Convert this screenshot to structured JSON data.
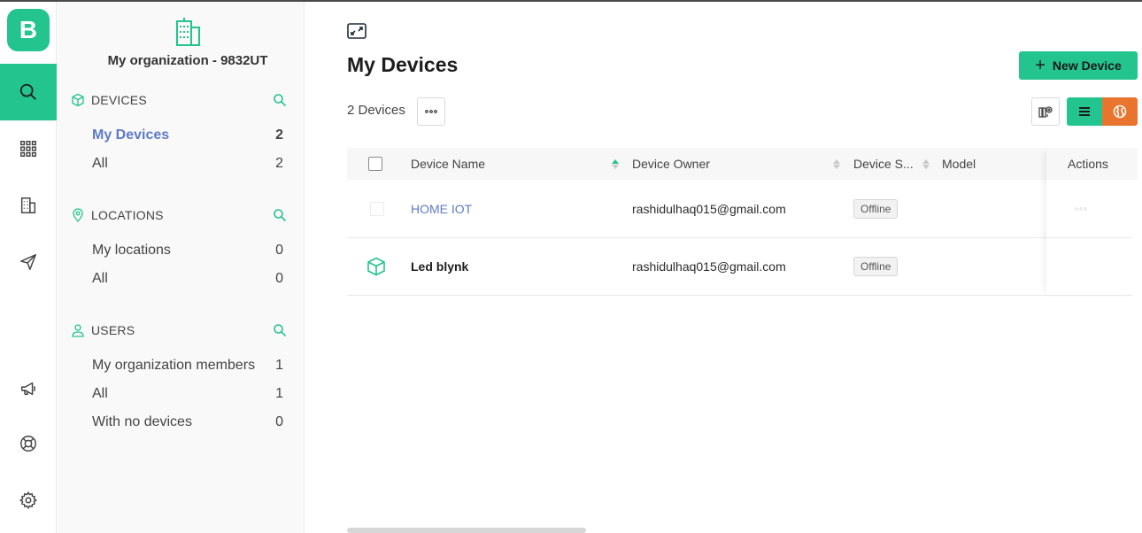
{
  "rail": {
    "logo": "B",
    "items": [
      {
        "name": "search-icon",
        "active": true
      },
      {
        "name": "apps-grid-icon",
        "active": false
      },
      {
        "name": "building-icon",
        "active": false
      },
      {
        "name": "send-icon",
        "active": false
      },
      {
        "name": "megaphone-icon",
        "active": false
      },
      {
        "name": "lifebuoy-icon",
        "active": false
      },
      {
        "name": "settings-gear-icon",
        "active": false
      }
    ]
  },
  "sidebar": {
    "org_title": "My organization - 9832UT",
    "sections": [
      {
        "title": "DEVICES",
        "icon": "cube-icon",
        "items": [
          {
            "label": "My Devices",
            "count": "2",
            "selected": true
          },
          {
            "label": "All",
            "count": "2",
            "selected": false
          }
        ]
      },
      {
        "title": "LOCATIONS",
        "icon": "location-pin-icon",
        "items": [
          {
            "label": "My locations",
            "count": "0",
            "selected": false
          },
          {
            "label": "All",
            "count": "0",
            "selected": false
          }
        ]
      },
      {
        "title": "USERS",
        "icon": "user-icon",
        "items": [
          {
            "label": "My organization members",
            "count": "1",
            "selected": false
          },
          {
            "label": "All",
            "count": "1",
            "selected": false
          },
          {
            "label": "With no devices",
            "count": "0",
            "selected": false
          }
        ]
      }
    ]
  },
  "main": {
    "title": "My Devices",
    "new_button": "New Device",
    "device_count": "2 Devices",
    "accent": "#23c48e",
    "map_color": "#e8742d",
    "table": {
      "columns": {
        "name": "Device Name",
        "owner": "Device Owner",
        "status": "Device S...",
        "model": "Model",
        "actions": "Actions"
      },
      "rows": [
        {
          "name": "HOME IOT",
          "owner": "rashidulhaq015@gmail.com",
          "status": "Offline",
          "model": "",
          "link": true
        },
        {
          "name": "Led blynk",
          "owner": "rashidulhaq015@gmail.com",
          "status": "Offline",
          "model": "",
          "link": false
        }
      ]
    }
  }
}
